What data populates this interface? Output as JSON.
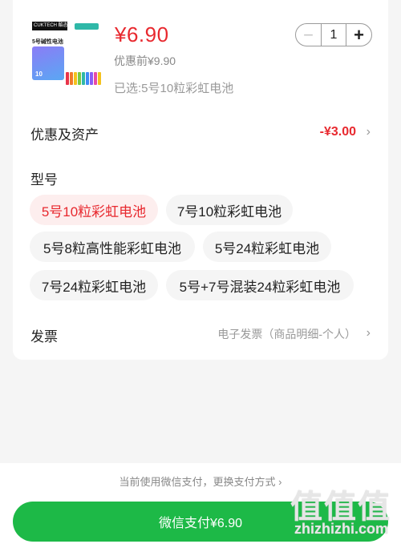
{
  "product": {
    "thumb_brand": "CUKTECH 酷态科",
    "thumb_title": "5号碱性电池",
    "thumb_count": "10",
    "battery_colors": [
      "#e8344a",
      "#f07a2a",
      "#f4c21d",
      "#7ac943",
      "#2fb8a8",
      "#3d8af7",
      "#8b5cf6",
      "#e84aa8",
      "#f4c21d",
      "#7ac943"
    ],
    "price": "¥6.90",
    "original_price": "优惠前¥9.90",
    "selected_spec": "已选:5号10粒彩虹电池"
  },
  "stepper": {
    "minus_label": "−",
    "quantity": "1",
    "plus_label": "+"
  },
  "discount": {
    "label": "优惠及资产",
    "value": "-¥3.00",
    "chevron": "›"
  },
  "model": {
    "label": "型号",
    "options": [
      {
        "label": "5号10粒彩虹电池",
        "selected": true
      },
      {
        "label": "7号10粒彩虹电池",
        "selected": false
      },
      {
        "label": "5号8粒高性能彩虹电池",
        "selected": false
      },
      {
        "label": "5号24粒彩虹电池",
        "selected": false
      },
      {
        "label": "7号24粒彩虹电池",
        "selected": false
      },
      {
        "label": "5号+7号混装24粒彩虹电池",
        "selected": false
      }
    ]
  },
  "invoice": {
    "label": "发票",
    "value": "电子发票（商品明细-个人）",
    "chevron": "›"
  },
  "payment": {
    "note": "当前使用微信支付，更换支付方式 ›",
    "button_label": "微信支付¥6.90"
  },
  "watermark": {
    "glyphs": "值值值",
    "text": "zhizhizhi.com"
  },
  "colors": {
    "accent_red": "#e8292f",
    "pay_green": "#1db947"
  }
}
